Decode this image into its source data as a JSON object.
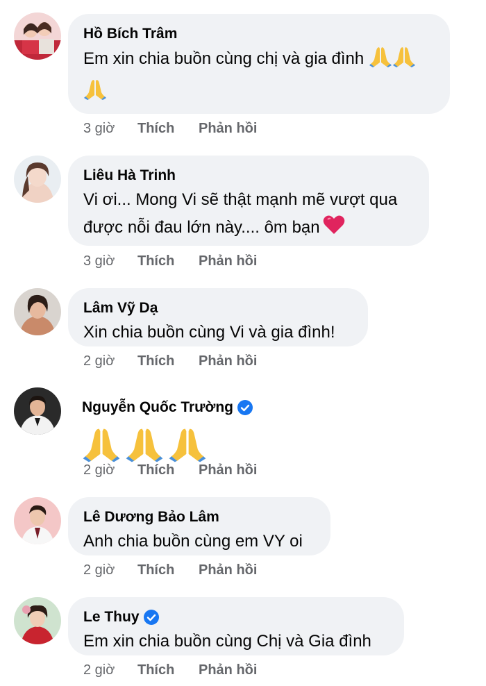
{
  "comments": [
    {
      "author": "Hồ Bích Trâm",
      "verified": false,
      "text": "Em xin chia buồn cùng chị và gia đình",
      "emoji": [
        "folded-hands",
        "folded-hands",
        "folded-hands"
      ],
      "time": "3 giờ",
      "like_label": "Thích",
      "reply_label": "Phản hồi"
    },
    {
      "author": "Liêu Hà Trinh",
      "verified": false,
      "text_line1": "Vi ơi... Mong Vi sẽ thật mạnh mẽ vượt qua",
      "text_line2": "được nỗi đau lớn này.... ôm bạn",
      "emoji": [
        "red-heart"
      ],
      "time": "3 giờ",
      "like_label": "Thích",
      "reply_label": "Phản hồi"
    },
    {
      "author": "Lâm Vỹ Dạ",
      "verified": false,
      "text": "Xin chia buồn cùng Vi và gia đình!",
      "time": "2 giờ",
      "like_label": "Thích",
      "reply_label": "Phản hồi"
    },
    {
      "author": "Nguyễn Quốc Trường",
      "verified": true,
      "emoji": [
        "folded-hands",
        "folded-hands",
        "folded-hands"
      ],
      "time": "2 giờ",
      "like_label": "Thích",
      "reply_label": "Phản hồi"
    },
    {
      "author": "Lê Dương Bảo Lâm",
      "verified": false,
      "text": "Anh chia buồn cùng em VY oi",
      "time": "2 giờ",
      "like_label": "Thích",
      "reply_label": "Phản hồi"
    },
    {
      "author": "Le Thuy",
      "verified": true,
      "text": "Em xin chia buồn cùng Chị và Gia đình",
      "time": "2 giờ",
      "like_label": "Thích",
      "reply_label": "Phản hồi"
    }
  ],
  "colors": {
    "bubble": "#f0f2f5",
    "meta_text": "#65676b",
    "verified_badge": "#1877f2",
    "heart": "#e0245e",
    "pray": "#f6c13c"
  }
}
